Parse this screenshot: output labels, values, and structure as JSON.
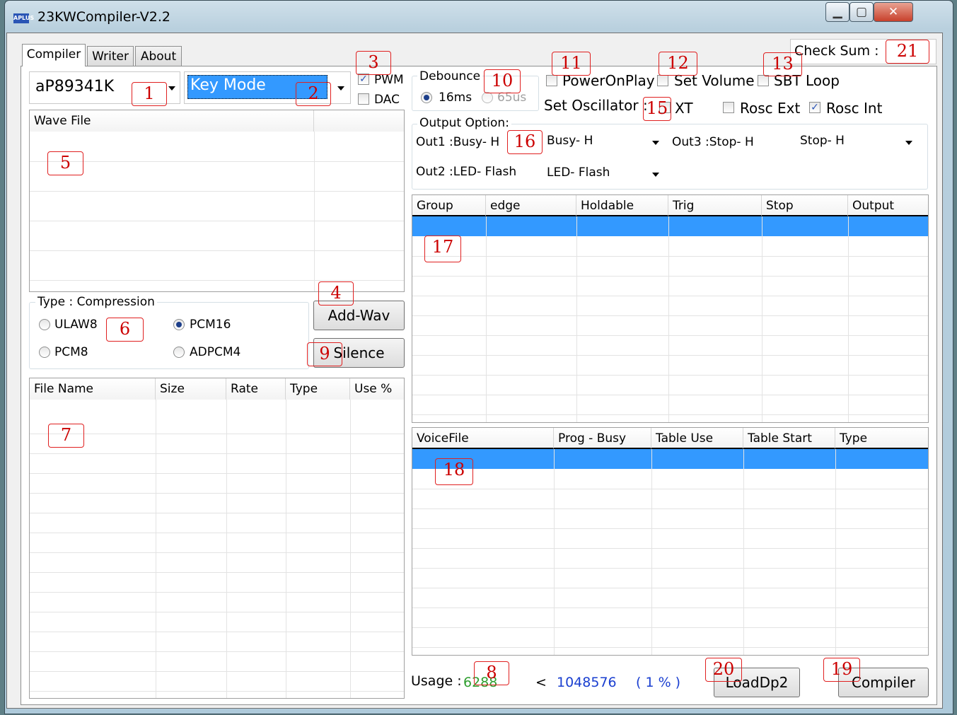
{
  "window": {
    "title": "23KWCompiler-V2.2",
    "app_icon": "APLUS",
    "min": "▁",
    "max": "▢",
    "close": "✕"
  },
  "tabs": [
    "Compiler",
    "Writer",
    "About"
  ],
  "left": {
    "chip": "aP89341K",
    "mode": "Key Mode",
    "pwm": "PWM",
    "dac": "DAC",
    "wave_header": "Wave File",
    "type_group": "Type : Compression",
    "ulaw8": "ULAW8",
    "pcm16": "PCM16",
    "pcm8": "PCM8",
    "adpcm4": "ADPCM4",
    "add_wav": "Add-Wav",
    "silence": "Silence",
    "file_columns": [
      "File Name",
      "Size",
      "Rate",
      "Type",
      "Use %"
    ]
  },
  "right": {
    "debounce": "Debounce",
    "d16": "16ms",
    "d65": "65us",
    "poweronplay": "PowerOnPlay",
    "set_volume": "Set Volume",
    "sbt_loop": "SBT Loop",
    "check_sum": "Check Sum :",
    "set_osc": "Set Oscillator :",
    "xt": "XT",
    "rosc_ext": "Rosc Ext",
    "rosc_int": "Rosc Int",
    "output_option": "Output Option:",
    "out1_label": "Out1 :Busy- H",
    "out1_value": "Busy- H",
    "out3_label": "Out3 :Stop- H",
    "out3_value": "Stop- H",
    "out2_label": "Out2 :LED- Flash",
    "out2_value": "LED- Flash",
    "group_columns": [
      "Group",
      "edge",
      "Holdable",
      "Trig",
      "Stop",
      "Output"
    ],
    "voice_columns": [
      "VoiceFile",
      "Prog - Busy",
      "Table Use",
      "Table Start",
      "Type"
    ],
    "usage_label": "Usage :",
    "usage_value": "6288",
    "lt": "<",
    "usage_total": "1048576",
    "usage_pct": "( 1 % )",
    "loaddp2": "LoadDp2",
    "compiler": "Compiler"
  },
  "annotations": [
    "1",
    "2",
    "3",
    "4",
    "5",
    "6",
    "7",
    "8",
    "9",
    "10",
    "11",
    "12",
    "13",
    "15",
    "16",
    "17",
    "18",
    "19",
    "20",
    "21"
  ],
  "colors": {
    "selection": "#3399ff",
    "annotation": "#e02020",
    "usage_value": "#2e9e2e",
    "usage_total": "#1a3fd0"
  }
}
